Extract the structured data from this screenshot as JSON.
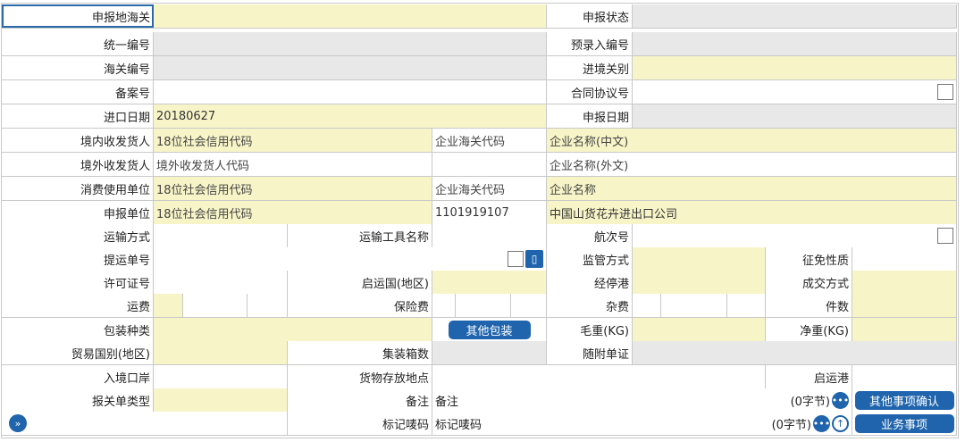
{
  "rows": {
    "r0": {
      "l1": "申报地海关",
      "l2": "申报状态"
    },
    "r1": {
      "l1": "统一编号",
      "l2": "预录入编号"
    },
    "r2": {
      "l1": "海关编号",
      "l2": "进境关别"
    },
    "r3": {
      "l1": "备案号",
      "l2": "合同协议号"
    },
    "r4": {
      "l1": "进口日期",
      "v1": "20180627",
      "l2": "申报日期"
    },
    "r5": {
      "l1": "境内收发货人",
      "v1": "18位社会信用代码",
      "v2": "企业海关代码",
      "v3": "企业名称(中文)"
    },
    "r6": {
      "l1": "境外收发货人",
      "v1": "境外收发货人代码",
      "v3": "企业名称(外文)"
    },
    "r7": {
      "l1": "消费使用单位",
      "v1": "18位社会信用代码",
      "v2": "企业海关代码",
      "v3": "企业名称"
    },
    "r8": {
      "l1": "申报单位",
      "v1": "18位社会信用代码",
      "v2": "1101919107",
      "v3": "中国山货花卉进出口公司"
    },
    "r9": {
      "l1": "运输方式",
      "l2": "运输工具名称",
      "l3": "航次号"
    },
    "r10": {
      "l1": "提运单号",
      "l2": "监管方式",
      "l3": "征免性质"
    },
    "r11": {
      "l1": "许可证号",
      "l2": "启运国(地区)",
      "l3": "经停港",
      "l4": "成交方式"
    },
    "r12": {
      "l1": "运费",
      "l2": "保险费",
      "l3": "杂费",
      "l4": "件数"
    },
    "r13": {
      "l1": "包装种类",
      "btn": "其他包装",
      "l3": "毛重(KG)",
      "l4": "净重(KG)"
    },
    "r14": {
      "l1": "贸易国别(地区)",
      "l2": "集装箱数",
      "l3": "随附单证"
    },
    "r15": {
      "l1": "入境口岸",
      "l2": "货物存放地点",
      "l4": "启运港"
    },
    "r16": {
      "l1": "报关单类型",
      "l2": "备注",
      "v1": "备注",
      "count": "(0字节)",
      "btn": "其他事项确认"
    },
    "r17": {
      "l2": "标记唛码",
      "v1": "标记唛码",
      "count": "(0字节)",
      "btn": "业务事项"
    }
  }
}
